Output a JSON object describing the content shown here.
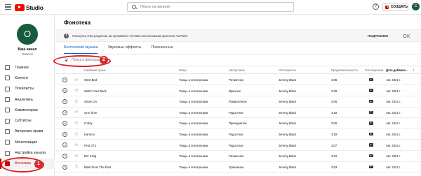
{
  "app": {
    "logo_text": "Studio"
  },
  "search": {
    "placeholder": "Поиск на канале"
  },
  "header": {
    "help_glyph": "?",
    "create_label": "СОЗДАТЬ",
    "avatar_letter": "C"
  },
  "channel": {
    "avatar_letter": "O",
    "name": "Ваш канал",
    "subtitle": "Owlation"
  },
  "sidebar": {
    "items": [
      {
        "label": "Главная",
        "icon": "dashboard-icon"
      },
      {
        "label": "Контент",
        "icon": "content-icon"
      },
      {
        "label": "Плейлисты",
        "icon": "playlists-icon"
      },
      {
        "label": "Аналитика",
        "icon": "analytics-icon"
      },
      {
        "label": "Комментарии",
        "icon": "comments-icon"
      },
      {
        "label": "Субтитры",
        "icon": "subtitles-icon"
      },
      {
        "label": "Авторские права",
        "icon": "copyright-icon"
      },
      {
        "label": "Монетизация",
        "icon": "monetization-icon"
      },
      {
        "label": "Настройка канала",
        "icon": "customization-icon"
      },
      {
        "label": "Фонотека",
        "icon": "audio-library-icon",
        "active": true
      }
    ]
  },
  "main": {
    "title": "Фонотека",
    "notice": {
      "icon_glyph": "i",
      "text": "Пользуясь этим разделом, вы принимаете Условия использования фонотеки YouTube.",
      "more_label": "ПОДРОБНЕЕ",
      "close_label": "ОК"
    },
    "tabs": [
      {
        "label": "Бесплатная музыка",
        "active": true
      },
      {
        "label": "Звуковые эффекты"
      },
      {
        "label": "Помеченные"
      }
    ],
    "filter": {
      "placeholder": "Поиск и фильтры"
    }
  },
  "table": {
    "headers": {
      "name": "Название трека",
      "genre": "Жанр",
      "mood": "Настроение",
      "artist": "Исполнитель",
      "duration": "Продолжительность",
      "license": "Тип лицензии",
      "date": "Дата добавле..."
    },
    "sort_arrow": "↓",
    "rows": [
      {
        "name": "West Bed",
        "genre": "Танцы и электроника",
        "mood": "Ритмичное",
        "artist": "Jeremy Black",
        "duration": "3:36",
        "date": "Авг. 2021 г."
      },
      {
        "name": "Watch Your Back",
        "genre": "Танцы и электроника",
        "mood": "Мрачное",
        "artist": "Jeremy Black",
        "duration": "2:29",
        "date": "Авг. 2021 г."
      },
      {
        "name": "Shore On",
        "genre": "Танцы и электроника",
        "mood": "Романтичное",
        "artist": "Jeremy Black",
        "duration": "3:06",
        "date": "Авг. 2021 г."
      },
      {
        "name": "One Time",
        "genre": "Танцы и электроника",
        "mood": "Радостное",
        "artist": "Jeremy Black",
        "duration": "3:18",
        "date": "Авг. 2021 г."
      },
      {
        "name": "O Boy",
        "genre": "Танцы и электроника",
        "mood": "Приподнятое",
        "artist": "Jeremy Black",
        "duration": "3:06",
        "date": "Авг. 2021 г."
      },
      {
        "name": "Harmon",
        "genre": "Танцы и электроника",
        "mood": "Радостное",
        "artist": "Jeremy Black",
        "duration": "3:19",
        "date": "Авг. 2021 г."
      },
      {
        "name": "First Of 3",
        "genre": "Танцы и электроника",
        "mood": "Радостное",
        "artist": "Jeremy Black",
        "duration": "3:07",
        "date": "Авг. 2021 г."
      },
      {
        "name": "Der Kinig",
        "genre": "Танцы и электроника",
        "mood": "Ритмичное",
        "artist": "Jeremy Black",
        "duration": "3:12",
        "date": "Авг. 2021 г."
      },
      {
        "name": "Blast From The Past",
        "genre": "Танцы и электроника",
        "mood": "Тревожное",
        "artist": "Jeremy Black",
        "duration": "2:53",
        "date": "Авг. 2021 г."
      }
    ]
  },
  "annotations": [
    {
      "number": "1",
      "color": "#d32f2f"
    },
    {
      "number": "2",
      "color": "#d32f2f"
    }
  ]
}
